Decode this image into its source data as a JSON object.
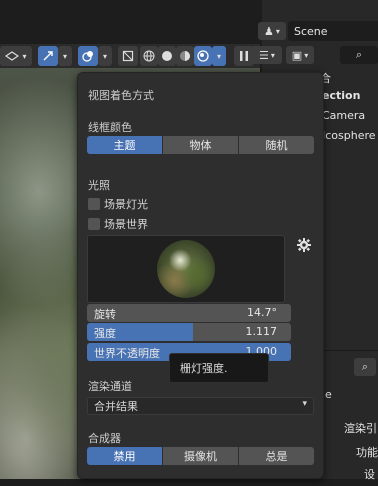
{
  "header": {
    "scene_label": "Scene",
    "scene_icon": "scene-icon"
  },
  "outliner": {
    "rows": [
      "合",
      "ection",
      "Camera",
      "Icosphere"
    ]
  },
  "properties": {
    "rows": [
      "ne",
      "渲染引",
      "功能",
      "设"
    ]
  },
  "shading_popup": {
    "title": "视图着色方式",
    "wireframe_color": {
      "label": "线框颜色",
      "options": [
        "主题",
        "物体",
        "随机"
      ],
      "selected": "主题"
    },
    "lighting": {
      "label": "光照",
      "scene_lights_label": "场景灯光",
      "scene_world_label": "场景世界",
      "scene_lights_checked": false,
      "scene_world_checked": false
    },
    "hdri": {
      "rotation_label": "旋转",
      "rotation_value": "14.7°",
      "strength_label": "强度",
      "strength_value": "1.117",
      "strength_fraction": 0.52,
      "world_opacity_label": "世界不透明度",
      "world_opacity_value": "1.000",
      "world_opacity_fraction": 1.0
    },
    "render_pass": {
      "label": "渲染通道",
      "value": "合并结果"
    },
    "compositor": {
      "label": "合成器",
      "options": [
        "禁用",
        "摄像机",
        "总是"
      ],
      "selected": "禁用"
    }
  },
  "tooltip": {
    "text": "栅灯强度."
  },
  "colors": {
    "accent": "#4772b3",
    "panel": "#2e2e2e",
    "button": "#545454"
  }
}
